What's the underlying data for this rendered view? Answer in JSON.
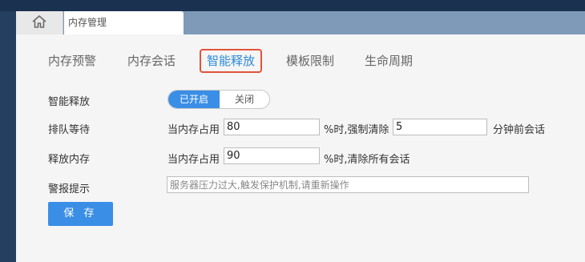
{
  "window": {
    "home_icon": "home-icon",
    "tab_title": "内存管理"
  },
  "subtabs": [
    {
      "label": "内存预警",
      "active": false
    },
    {
      "label": "内存会话",
      "active": false
    },
    {
      "label": "智能释放",
      "active": true
    },
    {
      "label": "模板限制",
      "active": false
    },
    {
      "label": "生命周期",
      "active": false
    }
  ],
  "form": {
    "smart_release": {
      "label": "智能释放",
      "on_label": "已开启",
      "off_label": "关闭",
      "state": "on"
    },
    "queue": {
      "label": "排队等待",
      "prefix": "当内存占用",
      "percent_value": "80",
      "middle": "%时,强制清除",
      "minutes_value": "5",
      "suffix": "分钟前会话"
    },
    "release": {
      "label": "释放内存",
      "prefix": "当内存占用",
      "percent_value": "90",
      "suffix": "%时,清除所有会话"
    },
    "alert": {
      "label": "警报提示",
      "placeholder": "服务器压力过大,触发保护机制,请重新操作"
    },
    "save_label": "保 存"
  },
  "colors": {
    "accent": "#3a8ee6",
    "active_tab_border": "#e2533a",
    "tabbar": "#7f9ab9",
    "panel": "#f5f5f5"
  }
}
